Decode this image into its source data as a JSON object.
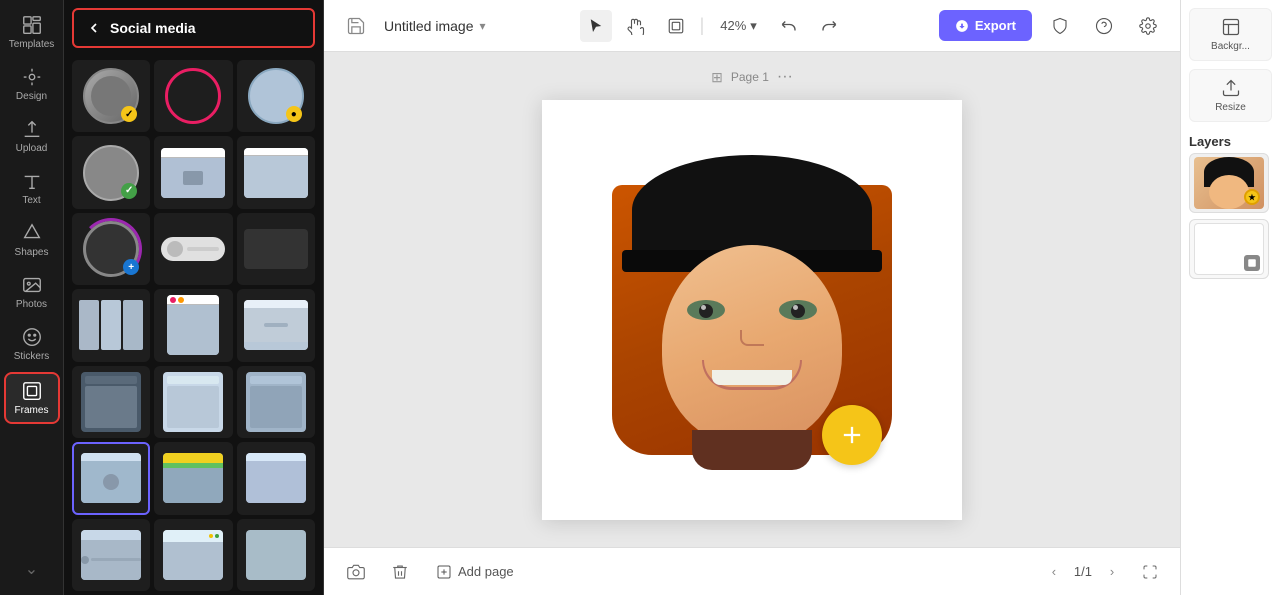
{
  "app": {
    "logo": "✕",
    "title": "Untitled image",
    "title_dropdown": "▾"
  },
  "sidebar": {
    "items": [
      {
        "id": "templates",
        "label": "Templates",
        "icon": "templates"
      },
      {
        "id": "design",
        "label": "Design",
        "icon": "design"
      },
      {
        "id": "upload",
        "label": "Upload",
        "icon": "upload"
      },
      {
        "id": "text",
        "label": "Text",
        "icon": "text"
      },
      {
        "id": "shapes",
        "label": "Shapes",
        "icon": "shapes"
      },
      {
        "id": "photos",
        "label": "Photos",
        "icon": "photos"
      },
      {
        "id": "stickers",
        "label": "Stickers",
        "icon": "stickers"
      },
      {
        "id": "frames",
        "label": "Frames",
        "icon": "frames"
      }
    ]
  },
  "panel": {
    "back_label": "Social media",
    "back_arrow": "‹"
  },
  "toolbar": {
    "select_tool": "▶",
    "hand_tool": "✋",
    "frame_tool": "⬜",
    "zoom": "42%",
    "zoom_arrow": "▾",
    "undo": "↺",
    "redo": "↻",
    "export_label": "Export",
    "export_icon": "↑",
    "shield_icon": "🛡",
    "help_icon": "?",
    "settings_icon": "⚙"
  },
  "canvas": {
    "page_label": "Page 1",
    "page_icon": "⊞",
    "page_dots": "···"
  },
  "right_panel": {
    "title": "Layers",
    "background_label": "Backgr...",
    "resize_label": "Resize"
  },
  "bottom_bar": {
    "camera_icon": "📷",
    "trash_icon": "🗑",
    "add_page_icon": "⊕",
    "add_page_label": "Add page",
    "page_current": "1/1",
    "nav_prev": "‹",
    "nav_next": "›",
    "expand_icon": "⛶"
  }
}
